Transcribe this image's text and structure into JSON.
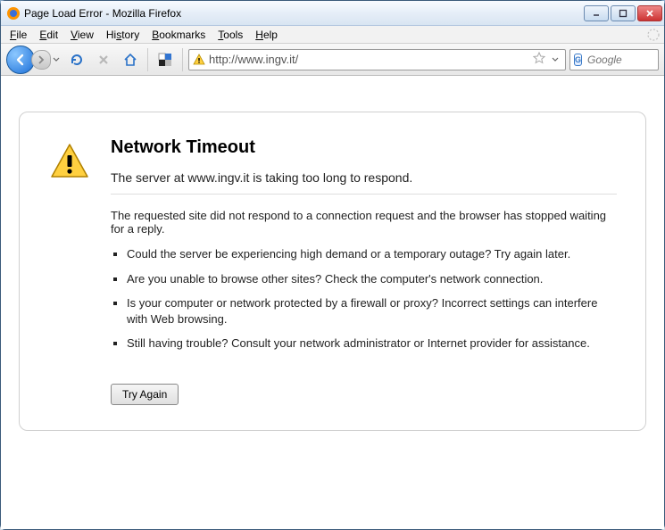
{
  "window": {
    "title": "Page Load Error - Mozilla Firefox"
  },
  "menu": {
    "items": [
      "File",
      "Edit",
      "View",
      "History",
      "Bookmarks",
      "Tools",
      "Help"
    ]
  },
  "toolbar": {
    "url": "http://www.ingv.it/",
    "search_placeholder": "Google",
    "search_engine_letter": "G"
  },
  "error": {
    "title": "Network Timeout",
    "subtitle": "The server at www.ingv.it is taking too long to respond.",
    "description": "The requested site did not respond to a connection request and the browser has stopped waiting for a reply.",
    "bullets": [
      "Could the server be experiencing high demand or a temporary outage? Try again later.",
      "Are you unable to browse other sites? Check the computer's network connection.",
      "Is your computer or network protected by a firewall or proxy? Incorrect settings can interfere with Web browsing.",
      "Still having trouble? Consult your network administrator or Internet provider for assistance."
    ],
    "try_again_label": "Try Again"
  }
}
